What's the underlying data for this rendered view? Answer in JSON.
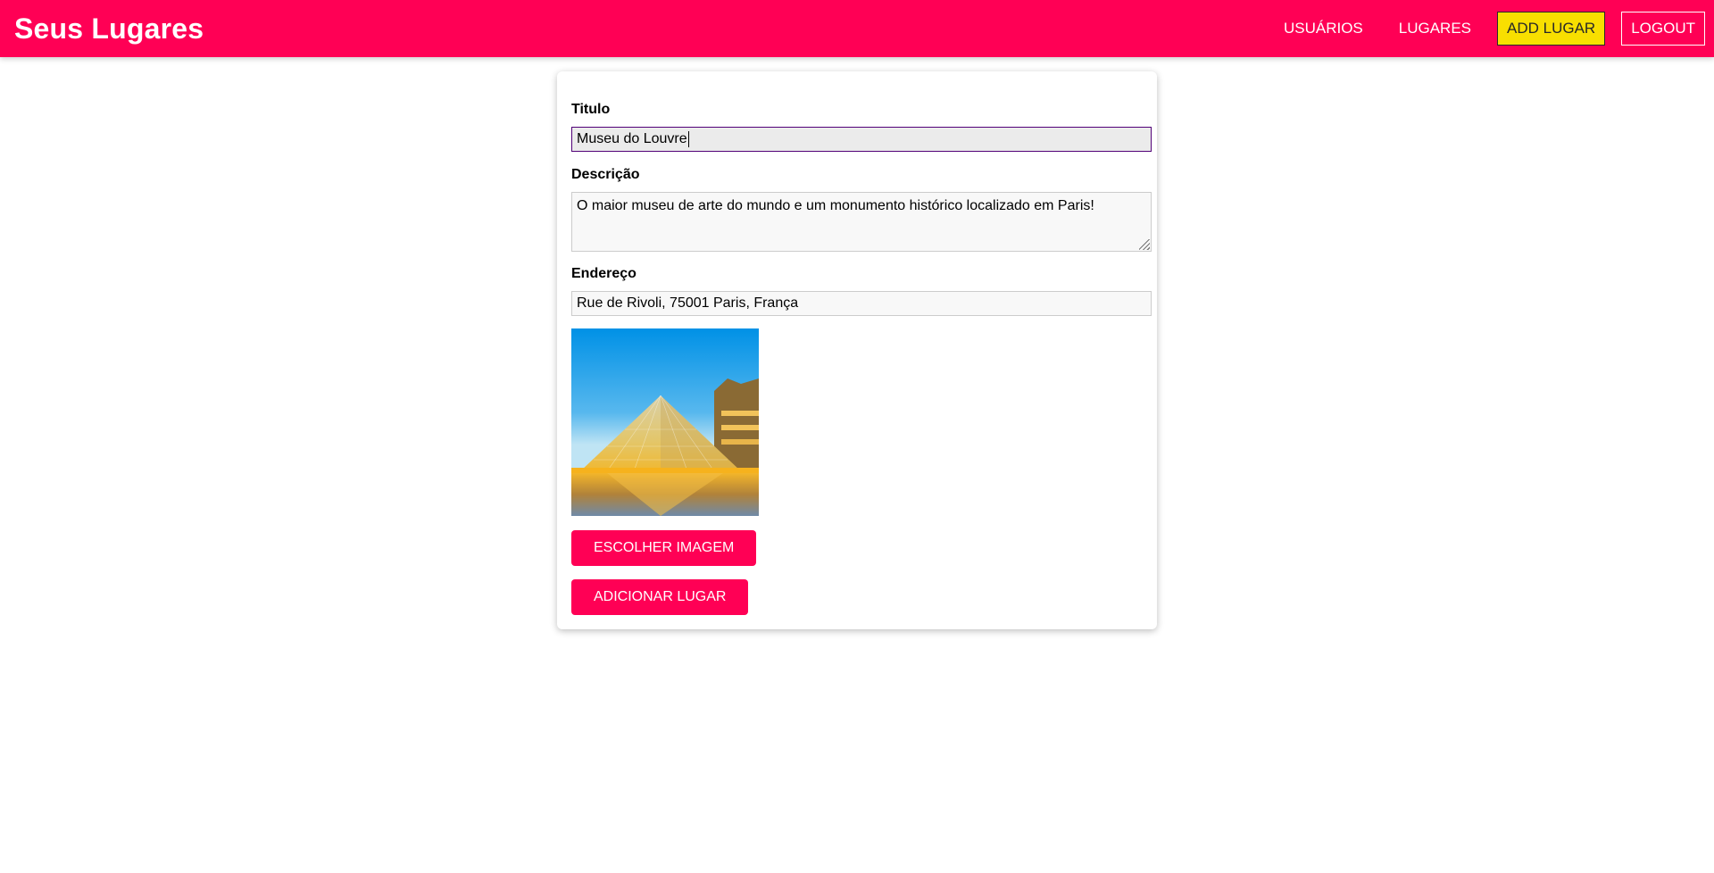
{
  "header": {
    "brand": "Seus Lugares",
    "nav": [
      {
        "label": "USUÁRIOS",
        "state": "default"
      },
      {
        "label": "LUGARES",
        "state": "default"
      },
      {
        "label": "ADD LUGAR",
        "state": "active"
      },
      {
        "label": "LOGOUT",
        "state": "outlined"
      }
    ]
  },
  "form": {
    "title": {
      "label": "Titulo",
      "value": "Museu do Louvre"
    },
    "description": {
      "label": "Descrição",
      "value": "O maior museu de arte do mundo e um monumento histórico localizado em Paris!"
    },
    "address": {
      "label": "Endereço",
      "value": "Rue de Rivoli, 75001 Paris, França"
    },
    "choose_image_label": "ESCOLHER IMAGEM",
    "submit_label": "ADICIONAR LUGAR"
  },
  "colors": {
    "brand": "#ff0055",
    "active_nav": "#f8df00",
    "focus_border": "#510077"
  }
}
